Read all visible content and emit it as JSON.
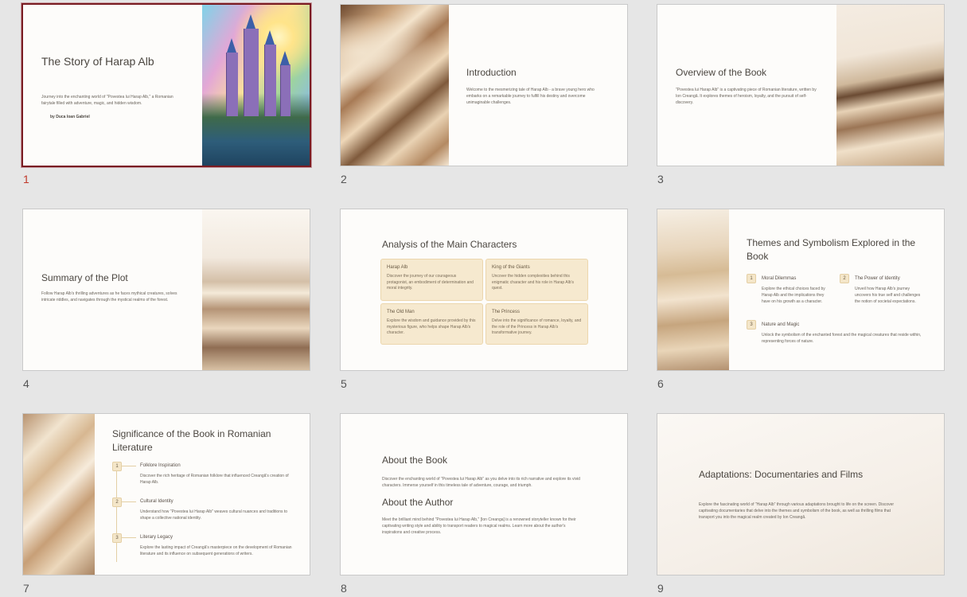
{
  "slides": [
    {
      "number": "1",
      "title": "The Story of Harap Alb",
      "body": "Journey into the enchanting world of \"Povestea lui Harap Alb,\" a Romanian fairytale filled with adventure, magic, and hidden wisdom.",
      "author": "by Duca Ioan Gabriel"
    },
    {
      "number": "2",
      "title": "Introduction",
      "body": "Welcome to the mesmerizing tale of Harap Alb - a brave young hero who embarks on a remarkable journey to fulfill his destiny and overcome unimaginable challenges."
    },
    {
      "number": "3",
      "title": "Overview of the Book",
      "body": "\"Povestea lui Harap Alb\" is a captivating piece of Romanian literature, written by Ion Creangă. It explores themes of heroism, loyalty, and the pursuit of self-discovery."
    },
    {
      "number": "4",
      "title": "Summary of the Plot",
      "body": "Follow Harap Alb's thrilling adventures as he faces mythical creatures, solves intricate riddles, and navigates through the mystical realms of the forest."
    },
    {
      "number": "5",
      "title": "Analysis of the Main Characters",
      "cards": [
        {
          "title": "Harap Alb",
          "body": "Discover the journey of our courageous protagonist, an embodiment of determination and moral integrity."
        },
        {
          "title": "King of the Giants",
          "body": "Uncover the hidden complexities behind this enigmatic character and his role in Harap Alb's quest."
        },
        {
          "title": "The Old Man",
          "body": "Explore the wisdom and guidance provided by this mysterious figure, who helps shape Harap Alb's character."
        },
        {
          "title": "The Princess",
          "body": "Delve into the significance of romance, loyalty, and the role of the Princess in Harap Alb's transformative journey."
        }
      ]
    },
    {
      "number": "6",
      "title": "Themes and Symbolism Explored in the Book",
      "items": [
        {
          "badge": "1",
          "title": "Moral Dilemmas",
          "body": "Explore the ethical choices faced by Harap Alb and the implications they have on his growth as a character."
        },
        {
          "badge": "2",
          "title": "The Power of Identity",
          "body": "Unveil how Harap Alb's journey uncovers his true self and challenges the notion of societal expectations."
        },
        {
          "badge": "3",
          "title": "Nature and Magic",
          "body": "Unlock the symbolism of the enchanted forest and the magical creatures that reside within, representing forces of nature."
        }
      ]
    },
    {
      "number": "7",
      "title": "Significance of the Book in Romanian Literature",
      "items": [
        {
          "badge": "1",
          "title": "Folklore Inspiration",
          "body": "Discover the rich heritage of Romanian folklore that influenced Creangă's creation of Harap Alb."
        },
        {
          "badge": "2",
          "title": "Cultural Identity",
          "body": "Understand how \"Povestea lui Harap Alb\" weaves cultural nuances and traditions to shape a collective national identity."
        },
        {
          "badge": "3",
          "title": "Literary Legacy",
          "body": "Explore the lasting impact of Creangă's masterpiece on the development of Romanian literature and its influence on subsequent generations of writers."
        }
      ]
    },
    {
      "number": "8",
      "title": "About the Book",
      "body": "Discover the enchanting world of \"Povestea lui Harap Alb\" as you delve into its rich narrative and explore its vivid characters. Immerse yourself in this timeless tale of adventure, courage, and triumph.",
      "title2": "About the Author",
      "body2": "Meet the brilliant mind behind \"Povestea lui Harap Alb,\" [Ion Creanga] is a renowned storyteller known for their captivating writing style and ability to transport readers to magical realms. Learn more about the author's inspirations and creative process."
    },
    {
      "number": "9",
      "title": "Adaptations: Documentaries and Films",
      "body": "Explore the fascinating world of \"Harap Alb\" through various adaptations brought to life on the screen. Discover captivating documentaries that delve into the themes and symbolism of the book, as well as thrilling films that transport you into the magical realm created by Ion Creangă."
    }
  ]
}
